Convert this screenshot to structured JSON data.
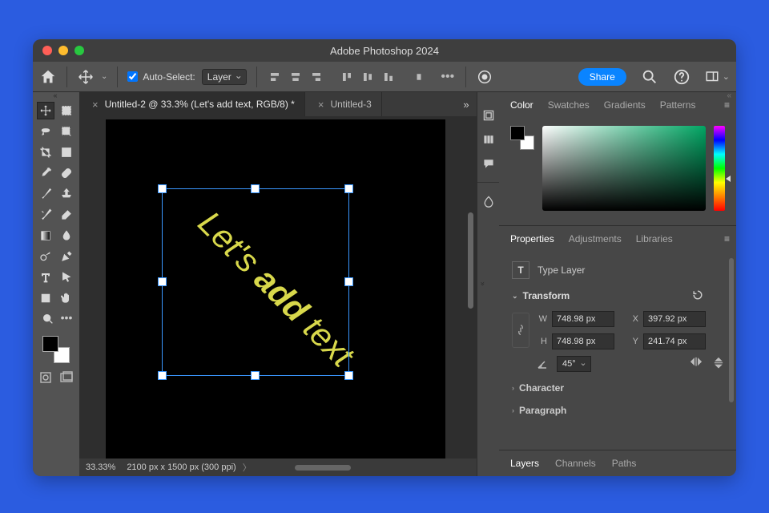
{
  "app_title": "Adobe Photoshop 2024",
  "options_bar": {
    "auto_select_label": "Auto-Select:",
    "auto_select_target": "Layer",
    "share_label": "Share"
  },
  "tabs": [
    {
      "label": "Untitled-2 @ 33.3% (Let's add text, RGB/8) *",
      "active": true
    },
    {
      "label": "Untitled-3",
      "active": false
    }
  ],
  "canvas": {
    "text_parts": {
      "a": "Let's ",
      "b": "add",
      "c": " text"
    }
  },
  "statusbar": {
    "zoom": "33.33%",
    "doc_info": "2100 px x 1500 px (300 ppi)"
  },
  "panels": {
    "color": {
      "tabs": [
        "Color",
        "Swatches",
        "Gradients",
        "Patterns"
      ],
      "active": 0
    },
    "properties": {
      "tabs": [
        "Properties",
        "Adjustments",
        "Libraries"
      ],
      "active": 0,
      "type_label": "Type Layer",
      "transform": {
        "title": "Transform",
        "W": "748.98 px",
        "H": "748.98 px",
        "X": "397.92 px",
        "Y": "241.74 px",
        "angle": "45°"
      },
      "character_label": "Character",
      "paragraph_label": "Paragraph"
    },
    "layers": {
      "tabs": [
        "Layers",
        "Channels",
        "Paths"
      ],
      "active": 0
    }
  }
}
